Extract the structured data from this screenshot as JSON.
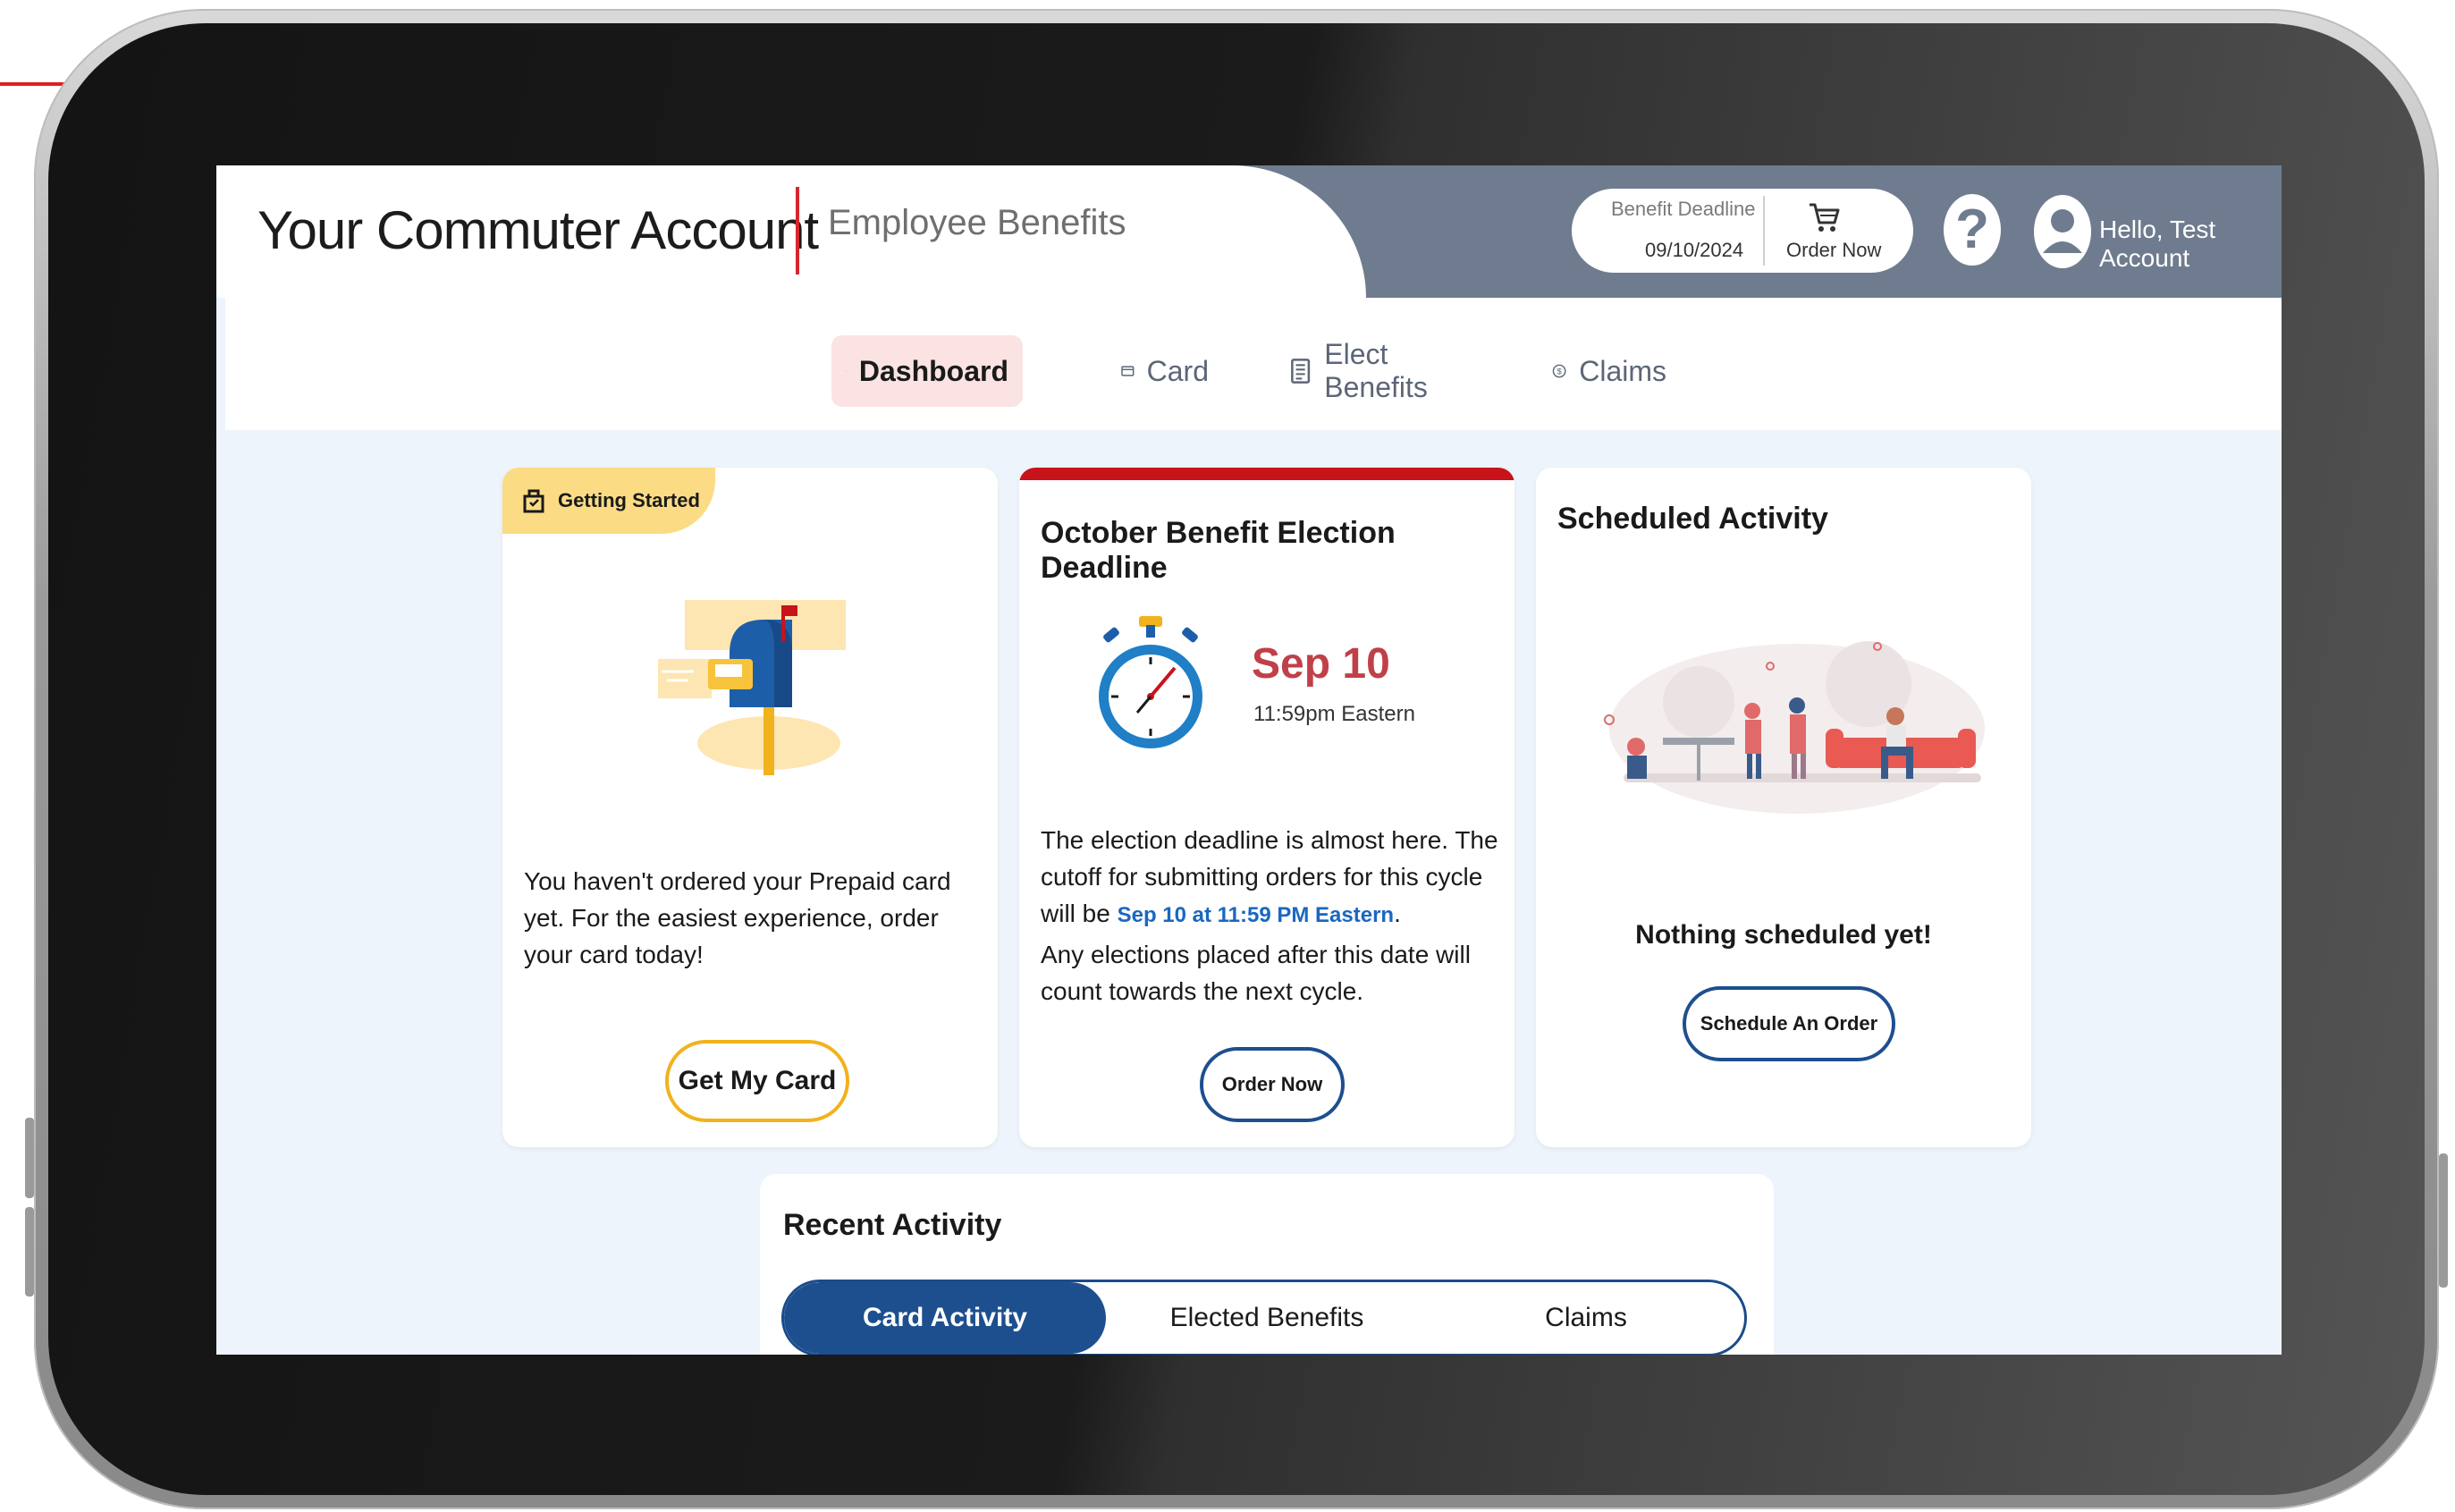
{
  "header": {
    "brand_title": "Your Commuter Account",
    "brand_subtitle": "Employee Benefits",
    "benefit_deadline_label": "Benefit Deadline",
    "benefit_deadline_date": "09/10/2024",
    "order_now_label": "Order Now",
    "help_symbol": "?",
    "greeting": "Hello, Test Account"
  },
  "nav": {
    "items": [
      {
        "label": "Dashboard",
        "icon": "home-icon",
        "active": true
      },
      {
        "label": "Card",
        "icon": "card-icon",
        "active": false
      },
      {
        "label": "Elect Benefits",
        "icon": "document-icon",
        "active": false
      },
      {
        "label": "Claims",
        "icon": "dollar-icon",
        "active": false
      }
    ]
  },
  "getting_started": {
    "chip_label": "Getting Started",
    "message": "You haven't ordered your Prepaid card yet. For the easiest experience, order your card today!",
    "button_label": "Get My Card"
  },
  "election_deadline": {
    "title": "October Benefit Election Deadline",
    "date": "Sep 10",
    "time": "11:59pm Eastern",
    "body_before": "The election deadline is almost here. The cutoff for submitting orders for this cycle will be",
    "body_link": "Sep 10 at 11:59 PM Eastern",
    "body_after": ".",
    "body_2": "Any elections placed after this date will count towards the next cycle.",
    "button_label": "Order Now"
  },
  "scheduled_activity": {
    "title": "Scheduled Activity",
    "empty_message": "Nothing scheduled yet!",
    "button_label": "Schedule An Order"
  },
  "recent_activity": {
    "title": "Recent Activity",
    "tabs": [
      "Card Activity",
      "Elected Benefits",
      "Claims"
    ],
    "active_tab": "Card Activity"
  },
  "colors": {
    "header_slate": "#6f7c8f",
    "brand_red": "#d7262c",
    "accent_blue": "#1d4f8f",
    "yellow": "#fbdc85",
    "date_red": "#c0404a"
  }
}
